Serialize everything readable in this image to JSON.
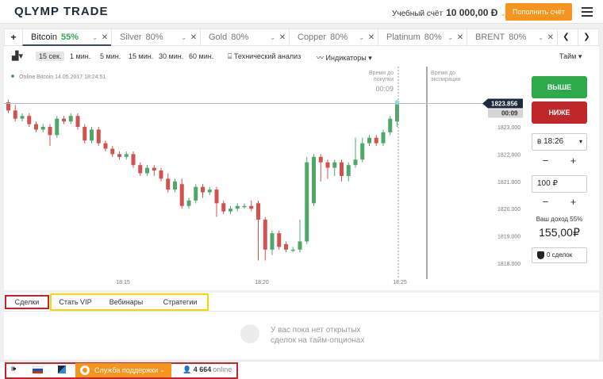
{
  "header": {
    "logo": "QLYMP TRADE",
    "account_label": "Учебный счёт",
    "balance": "10 000,00 Ð",
    "deposit_label": "Пополнить счёт"
  },
  "tabs": [
    {
      "name": "Bitcoin",
      "pct": "55%"
    },
    {
      "name": "Silver",
      "pct": "80%"
    },
    {
      "name": "Gold",
      "pct": "80%"
    },
    {
      "name": "Copper",
      "pct": "80%"
    },
    {
      "name": "Platinum",
      "pct": "80%"
    },
    {
      "name": "BRENT",
      "pct": "80%"
    }
  ],
  "toolbar": {
    "timeframes": [
      "15 сек.",
      "1 мин.",
      "5 мин.",
      "15 мин.",
      "30 мин.",
      "60 мин."
    ],
    "tech_analysis": "Технический анализ",
    "indicators": "Индикаторы",
    "theme": "Тайм"
  },
  "chart_data": {
    "type": "candlestick",
    "asset_info": "Online Bitcoin 14.05.2017 18:24:51",
    "purchase_label_1": "Время до",
    "purchase_label_2": "покупки",
    "purchase_timer": "00:09",
    "expiry_label_1": "Время до",
    "expiry_label_2": "экспирации",
    "current_price": "1823.856",
    "current_timer": "00:09",
    "y_ticks": [
      "1823.000",
      "1822.000",
      "1821.000",
      "1820.000",
      "1819.000",
      "1818.000"
    ],
    "x_ticks": [
      "18:15",
      "18:20",
      "18:25"
    ],
    "ylim": [
      1817.8,
      1824.5
    ],
    "up_color": "#4fa86a",
    "down_color": "#d0534f",
    "candles": [
      [
        1823.9,
        1823.6,
        1824.0,
        1823.5
      ],
      [
        1823.6,
        1823.3,
        1823.8,
        1823.2
      ],
      [
        1823.3,
        1823.4,
        1823.5,
        1823.2
      ],
      [
        1823.4,
        1823.1,
        1823.5,
        1823.0
      ],
      [
        1823.1,
        1822.9,
        1823.2,
        1822.8
      ],
      [
        1822.9,
        1823.0,
        1823.1,
        1822.8
      ],
      [
        1823.0,
        1822.7,
        1823.1,
        1822.3
      ],
      [
        1822.7,
        1823.3,
        1823.4,
        1822.6
      ],
      [
        1823.3,
        1823.2,
        1823.4,
        1823.1
      ],
      [
        1823.2,
        1823.4,
        1823.5,
        1823.1
      ],
      [
        1823.4,
        1823.0,
        1823.5,
        1822.9
      ],
      [
        1823.0,
        1822.5,
        1823.1,
        1822.4
      ],
      [
        1822.5,
        1822.9,
        1823.0,
        1822.4
      ],
      [
        1822.9,
        1822.4,
        1823.0,
        1822.3
      ],
      [
        1822.4,
        1822.2,
        1822.5,
        1822.1
      ],
      [
        1822.2,
        1822.0,
        1822.3,
        1821.9
      ],
      [
        1822.0,
        1821.9,
        1822.1,
        1821.8
      ],
      [
        1821.9,
        1822.0,
        1822.1,
        1821.8
      ],
      [
        1822.0,
        1821.6,
        1822.1,
        1821.5
      ],
      [
        1821.6,
        1821.3,
        1821.7,
        1821.2
      ],
      [
        1821.3,
        1821.5,
        1821.6,
        1821.2
      ],
      [
        1821.5,
        1821.4,
        1821.6,
        1821.2
      ],
      [
        1821.4,
        1821.1,
        1821.5,
        1821.0
      ],
      [
        1821.1,
        1820.7,
        1821.3,
        1820.6
      ],
      [
        1820.7,
        1821.0,
        1821.1,
        1820.6
      ],
      [
        1820.9,
        1820.1,
        1821.1,
        1820.0
      ],
      [
        1820.1,
        1820.3,
        1820.4,
        1820.0
      ],
      [
        1820.3,
        1820.8,
        1820.9,
        1820.2
      ],
      [
        1820.8,
        1820.6,
        1820.9,
        1820.4
      ],
      [
        1820.6,
        1820.7,
        1820.8,
        1820.5
      ],
      [
        1820.7,
        1820.2,
        1820.8,
        1819.7
      ],
      [
        1820.2,
        1819.9,
        1820.3,
        1819.8
      ],
      [
        1819.9,
        1820.0,
        1820.1,
        1819.8
      ],
      [
        1820.0,
        1820.1,
        1820.2,
        1819.9
      ],
      [
        1820.1,
        1820.1,
        1820.2,
        1820.0
      ],
      [
        1820.1,
        1820.0,
        1820.3,
        1819.9
      ],
      [
        1820.2,
        1819.6,
        1820.3,
        1818.1
      ],
      [
        1819.6,
        1818.5,
        1819.7,
        1818.1
      ],
      [
        1818.5,
        1819.1,
        1819.2,
        1818.3
      ],
      [
        1819.1,
        1818.6,
        1819.2,
        1818.5
      ],
      [
        1818.7,
        1818.5,
        1818.8,
        1818.4
      ],
      [
        1818.5,
        1818.5,
        1818.6,
        1818.4
      ],
      [
        1818.5,
        1818.8,
        1819.6,
        1818.4
      ],
      [
        1818.8,
        1821.7,
        1821.9,
        1818.7
      ],
      [
        1820.2,
        1821.9,
        1822.0,
        1820.1
      ],
      [
        1821.9,
        1821.7,
        1822.0,
        1821.0
      ],
      [
        1821.7,
        1821.5,
        1821.8,
        1821.1
      ],
      [
        1821.5,
        1821.7,
        1821.8,
        1821.2
      ],
      [
        1821.7,
        1821.2,
        1821.8,
        1821.0
      ],
      [
        1821.2,
        1821.6,
        1821.7,
        1821.0
      ],
      [
        1821.6,
        1821.8,
        1822.6,
        1821.5
      ],
      [
        1821.8,
        1822.4,
        1822.6,
        1821.7
      ],
      [
        1822.4,
        1822.6,
        1822.7,
        1822.3
      ],
      [
        1822.6,
        1822.4,
        1822.7,
        1822.3
      ],
      [
        1822.4,
        1822.8,
        1822.9,
        1822.3
      ],
      [
        1822.8,
        1823.3,
        1823.4,
        1822.7
      ],
      [
        1823.2,
        1823.9,
        1823.9,
        1823.0
      ]
    ]
  },
  "side": {
    "buy_label": "ВЫШЕ",
    "sell_label": "НИЖЕ",
    "time_value": "в 18:26",
    "amount_value": "100 ₽",
    "income_label": "Ваш доход 55%",
    "income_value": "155,00₽",
    "deals_label": "0 сделок",
    "minus": "−",
    "plus": "+"
  },
  "bottom_tabs": [
    "Сделки",
    "Стать VIP",
    "Вебинары",
    "Стратегии"
  ],
  "empty_deals": {
    "line1": "У вас пока нет открытых",
    "line2": "сделок на тайм-опционах"
  },
  "footer": {
    "support_label": "Служба поддержки",
    "online_count": "4 664",
    "online_label": "online"
  }
}
